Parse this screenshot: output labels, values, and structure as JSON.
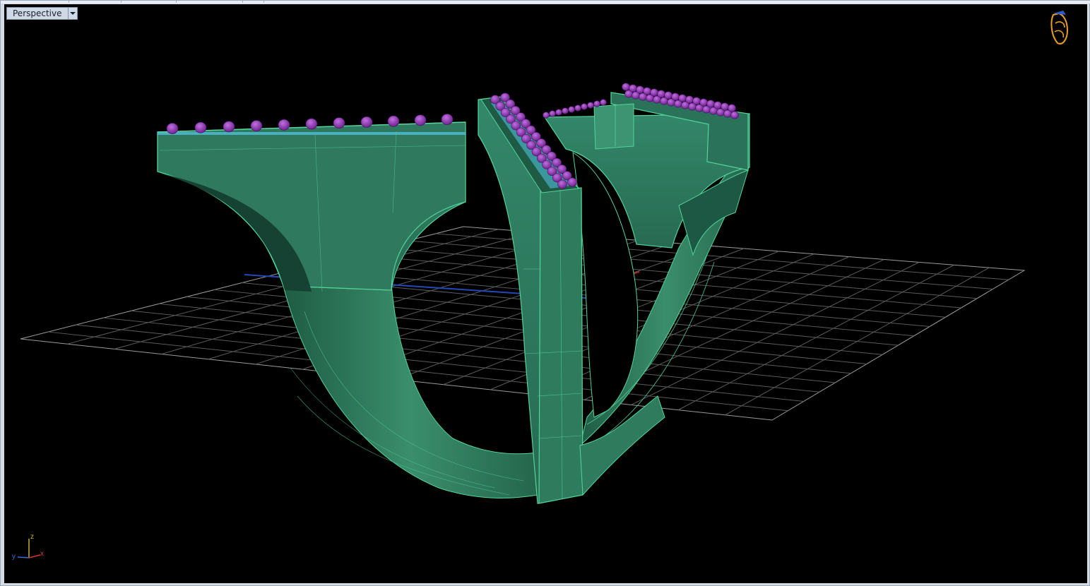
{
  "viewport": {
    "name": "Perspective",
    "dropdown_icon": "chevron-down-icon",
    "background": "#000000"
  },
  "axes_widget": {
    "x_label": "x",
    "y_label": "y",
    "z_label": "z",
    "x_color": "#d23a2a",
    "y_color": "#3a6bd8",
    "z_color": "#c8b030"
  },
  "model": {
    "body_color": "#2f7a5e",
    "stone_color": "#8a2aa8",
    "seat_color": "#56c8e8"
  },
  "logo_icon": "rhino-logo-icon"
}
